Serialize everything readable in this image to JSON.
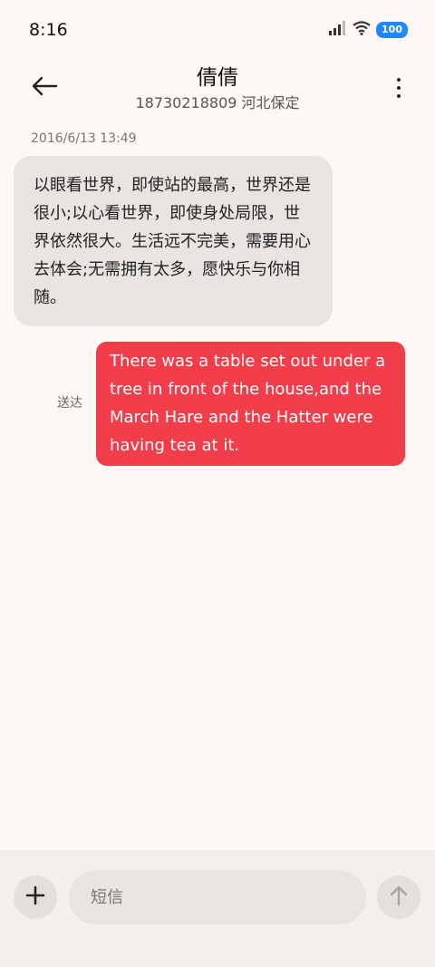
{
  "status_bar": {
    "time": "8:16",
    "battery": "100",
    "icons": [
      "signal-icon",
      "wifi-icon",
      "battery-icon"
    ]
  },
  "header": {
    "contact_name": "倩倩",
    "contact_subtitle": "18730218809 河北保定",
    "back_icon": "arrow-left-icon",
    "more_icon": "more-vertical-icon"
  },
  "conversation": {
    "timestamp": "2016/6/13 13:49",
    "messages": [
      {
        "direction": "incoming",
        "text": "以眼看世界，即使站的最高，世界还是很小;以心看世界，即使身处局限，世界依然很大。生活远不完美，需要用心去体会;无需拥有太多，愿快乐与你相随。"
      },
      {
        "direction": "outgoing",
        "status": "送达",
        "text": "There was a table set out under a tree in front of the house,and the March Hare and the Hatter were having tea at it."
      }
    ]
  },
  "composer": {
    "placeholder": "短信",
    "add_icon": "plus-icon",
    "send_icon": "arrow-up-icon"
  },
  "colors": {
    "outgoing_bubble": "#f23d4a",
    "incoming_bubble": "#e8e4e2",
    "background": "#fdf8f4",
    "battery": "#1e88ff"
  }
}
